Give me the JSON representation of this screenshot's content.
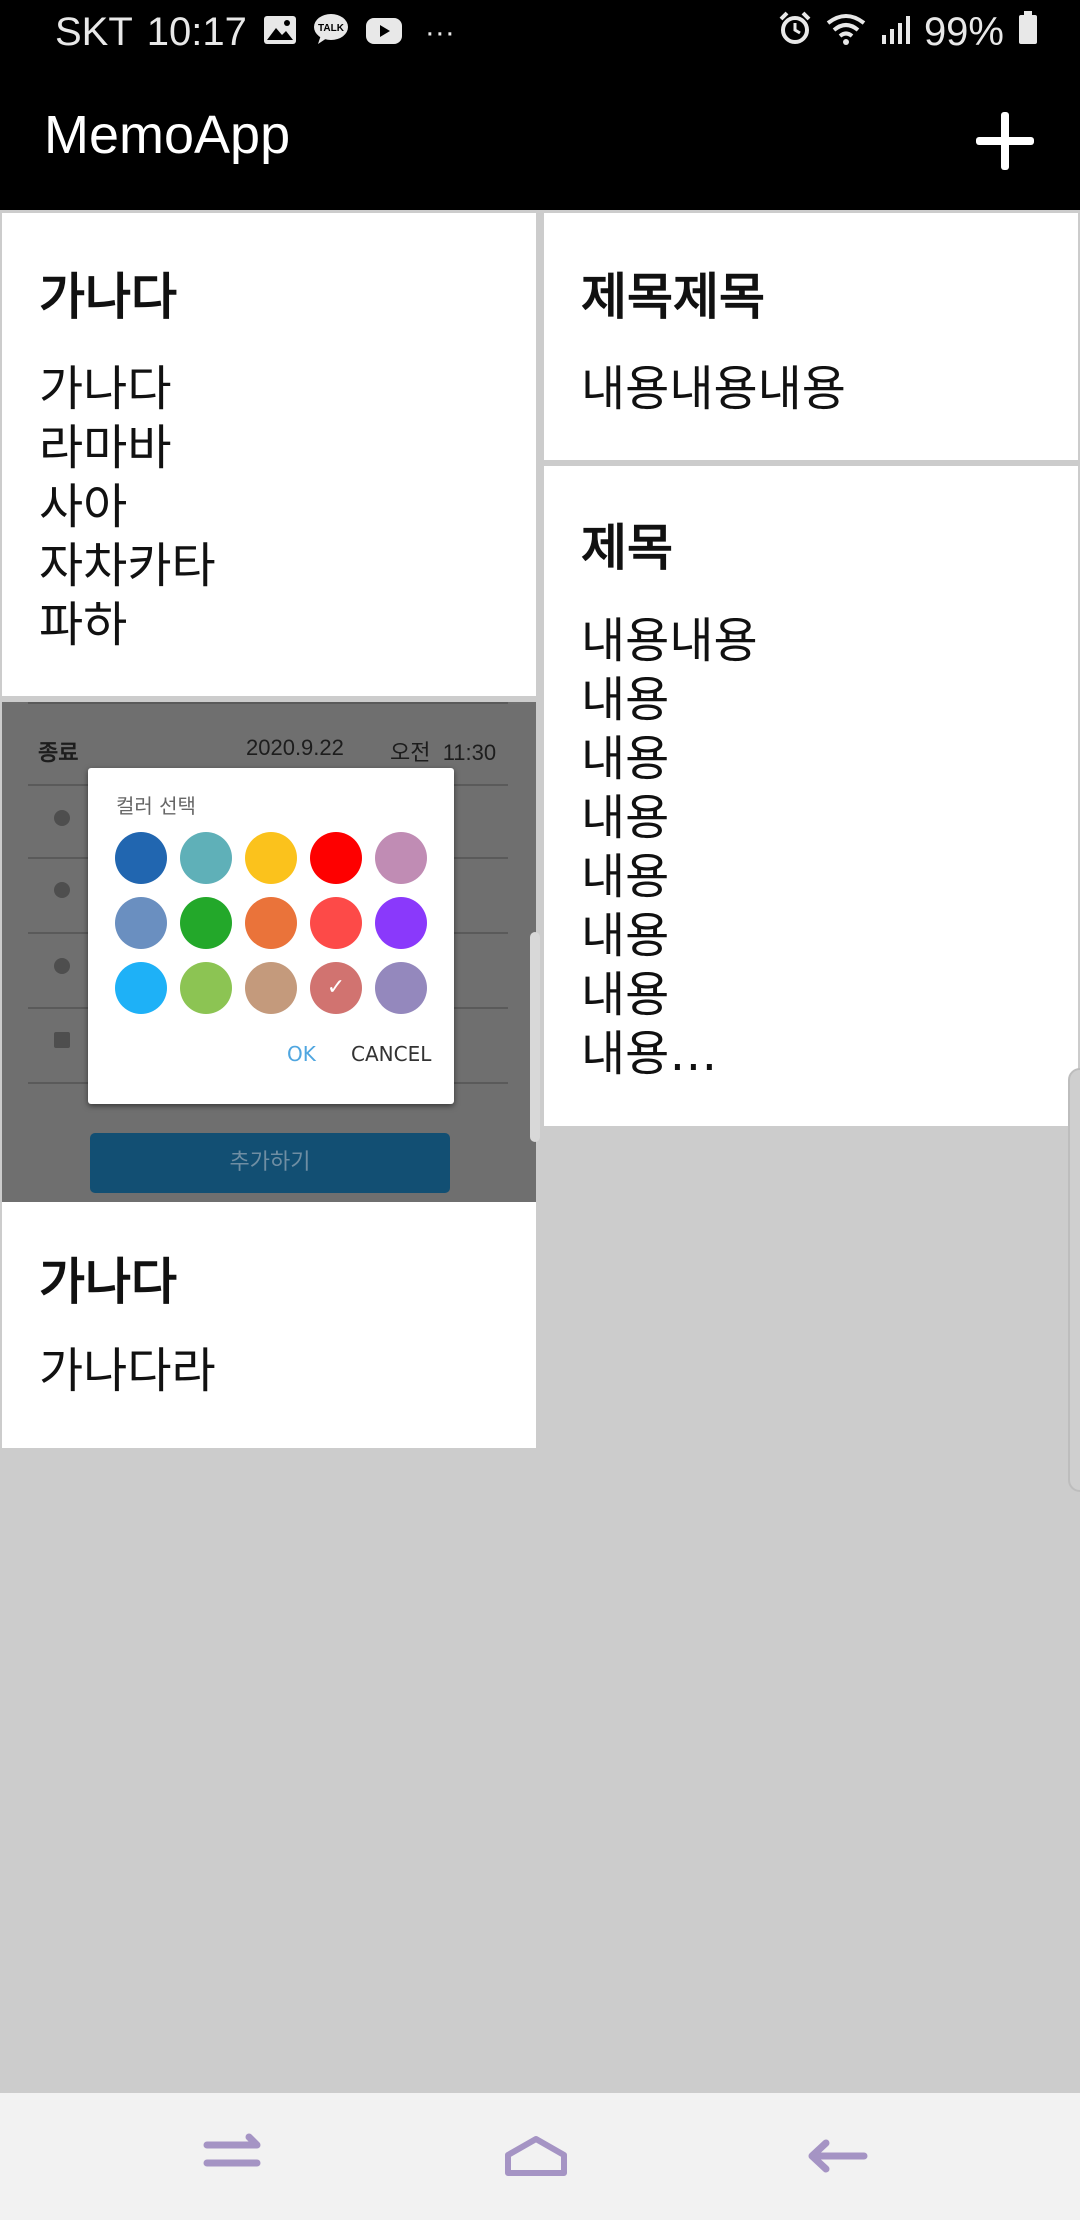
{
  "status_bar": {
    "carrier": "SKT",
    "time": "10:17",
    "battery": "99%",
    "icons": [
      "gallery-icon",
      "kakaotalk-icon",
      "youtube-icon",
      "more-dots-icon",
      "alarm-icon",
      "wifi-icon",
      "signal-icon",
      "battery-icon"
    ],
    "talk_badge": "TALK",
    "more": "···"
  },
  "app_bar": {
    "title": "MemoApp",
    "add_icon": "plus-icon",
    "background": "#000000"
  },
  "memos": [
    {
      "title": "가나다",
      "body": "가나다\n라마바\n사아\n자차카타\n파하"
    },
    {
      "title": "가나다",
      "body": "가나다라",
      "has_image": true
    },
    {
      "title": "제목제목",
      "body": "내용내용내용"
    },
    {
      "title": "제목",
      "body": "내용내용\n내용\n내용\n내용\n내용\n내용\n내용\n내용…"
    }
  ],
  "memo_image": {
    "row_label": "종료",
    "date": "2020.9.22",
    "time": "오전  11:30",
    "dialog_title": "컬러 선택",
    "colors": [
      "#2166b0",
      "#5fb0b8",
      "#fbc21c",
      "#fe0000",
      "#c08cb4",
      "#6a8fc0",
      "#23a82a",
      "#ea733a",
      "#fd4a48",
      "#8a39fb",
      "#1eb1f7",
      "#8cc453",
      "#c49a7c",
      "#d17370",
      "#9488bd"
    ],
    "selected_mark": "✓",
    "ok": "OK",
    "cancel": "CANCEL",
    "add_button": "추가하기"
  },
  "nav_bar": {
    "buttons": [
      "recents-icon",
      "home-icon",
      "back-icon"
    ],
    "accent": "#a594c4"
  },
  "colors": {
    "background": "#cccccc",
    "card": "#ffffff"
  }
}
